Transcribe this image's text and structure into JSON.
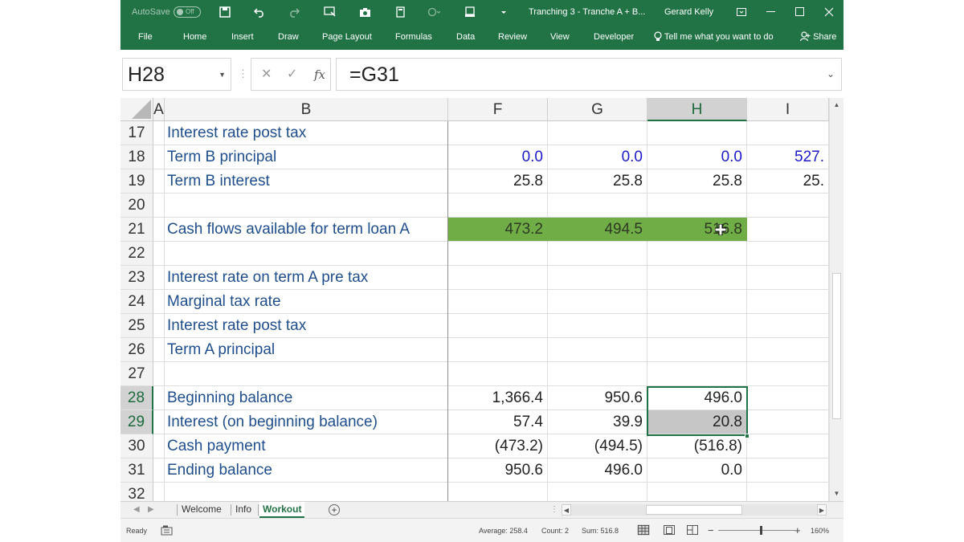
{
  "titlebar": {
    "autosave_label": "AutoSave",
    "autosave_state": "Off",
    "title": "Tranching 3 - Tranche A + B...",
    "user": "Gerard Kelly"
  },
  "ribbon": {
    "tabs": [
      "File",
      "Home",
      "Insert",
      "Draw",
      "Page Layout",
      "Formulas",
      "Data",
      "Review",
      "View",
      "Developer"
    ],
    "tell_me": "Tell me what you want to do",
    "share": "Share"
  },
  "formula_bar": {
    "name_box": "H28",
    "fx": "fx",
    "formula": "=G31"
  },
  "columns": [
    "A",
    "B",
    "F",
    "G",
    "H",
    "I"
  ],
  "rows": [
    {
      "num": "17",
      "label": "Interest rate post tax",
      "f": "",
      "g": "",
      "h": "",
      "i": ""
    },
    {
      "num": "18",
      "label": "Term B principal",
      "f": "0.0",
      "g": "0.0",
      "h": "0.0",
      "i": "527."
    },
    {
      "num": "19",
      "label": "Term B interest",
      "f": "25.8",
      "g": "25.8",
      "h": "25.8",
      "i": "25."
    },
    {
      "num": "20",
      "label": "",
      "f": "",
      "g": "",
      "h": "",
      "i": ""
    },
    {
      "num": "21",
      "label": "Cash flows available for term loan A",
      "f": "473.2",
      "g": "494.5",
      "h": "516.8",
      "i": ""
    },
    {
      "num": "22",
      "label": "",
      "f": "",
      "g": "",
      "h": "",
      "i": ""
    },
    {
      "num": "23",
      "label": "Interest rate on term A pre tax",
      "f": "",
      "g": "",
      "h": "",
      "i": ""
    },
    {
      "num": "24",
      "label": "Marginal tax rate",
      "f": "",
      "g": "",
      "h": "",
      "i": ""
    },
    {
      "num": "25",
      "label": "Interest rate post tax",
      "f": "",
      "g": "",
      "h": "",
      "i": ""
    },
    {
      "num": "26",
      "label": "Term A principal",
      "f": "",
      "g": "",
      "h": "",
      "i": ""
    },
    {
      "num": "27",
      "label": "",
      "f": "",
      "g": "",
      "h": "",
      "i": ""
    },
    {
      "num": "28",
      "label": "Beginning balance",
      "f": "1,366.4",
      "g": "950.6",
      "h": "496.0",
      "i": ""
    },
    {
      "num": "29",
      "label": "Interest (on beginning balance)",
      "f": "57.4",
      "g": "39.9",
      "h": "20.8",
      "i": ""
    },
    {
      "num": "30",
      "label": "Cash payment",
      "f": "(473.2)",
      "g": "(494.5)",
      "h": "(516.8)",
      "i": ""
    },
    {
      "num": "31",
      "label": "Ending balance",
      "f": "950.6",
      "g": "496.0",
      "h": "0.0",
      "i": ""
    },
    {
      "num": "32",
      "label": "",
      "f": "",
      "g": "",
      "h": "",
      "i": ""
    }
  ],
  "sheet_tabs": [
    "Welcome",
    "Info",
    "Workout"
  ],
  "active_sheet": "Workout",
  "statusbar": {
    "mode": "Ready",
    "average": "Average: 258.4",
    "count": "Count: 2",
    "sum": "Sum: 516.8",
    "zoom": "160%"
  },
  "colors": {
    "excel_green": "#217346",
    "highlight_green": "#70ad47",
    "label_blue": "#1f4e8c",
    "input_blue": "#1a1ac8"
  }
}
